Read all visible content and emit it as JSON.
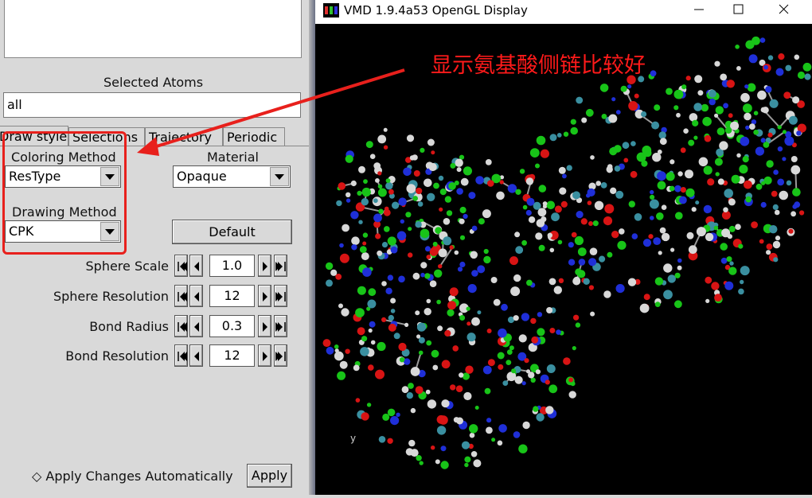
{
  "graphics_panel": {
    "selected_atoms_label": "Selected Atoms",
    "selected_atoms_value": "all",
    "tabs": [
      {
        "label": "Draw style",
        "active": true
      },
      {
        "label": "Selections",
        "active": false
      },
      {
        "label": "Trajectory",
        "active": false
      },
      {
        "label": "Periodic",
        "active": false
      }
    ],
    "coloring_method_label": "Coloring Method",
    "coloring_method_value": "ResType",
    "material_label": "Material",
    "material_value": "Opaque",
    "drawing_method_label": "Drawing Method",
    "drawing_method_value": "CPK",
    "default_button": "Default",
    "params": [
      {
        "label": "Sphere Scale",
        "value": "1.0"
      },
      {
        "label": "Sphere Resolution",
        "value": "12"
      },
      {
        "label": "Bond Radius",
        "value": "0.3"
      },
      {
        "label": "Bond Resolution",
        "value": "12"
      }
    ],
    "apply_auto_label": "Apply Changes Automatically",
    "apply_button": "Apply"
  },
  "vmd_window": {
    "title": "VMD 1.9.4a53 OpenGL Display",
    "axis_label": "y"
  },
  "annotation": {
    "text": "显示氨基酸侧链比较好",
    "color": "#ff1a1a"
  },
  "colors": {
    "atom_blue": "#1f2fd8",
    "atom_green": "#18c418",
    "atom_red": "#d81414",
    "atom_white": "#d8d8d8",
    "atom_cyan": "#3a8fa0"
  }
}
